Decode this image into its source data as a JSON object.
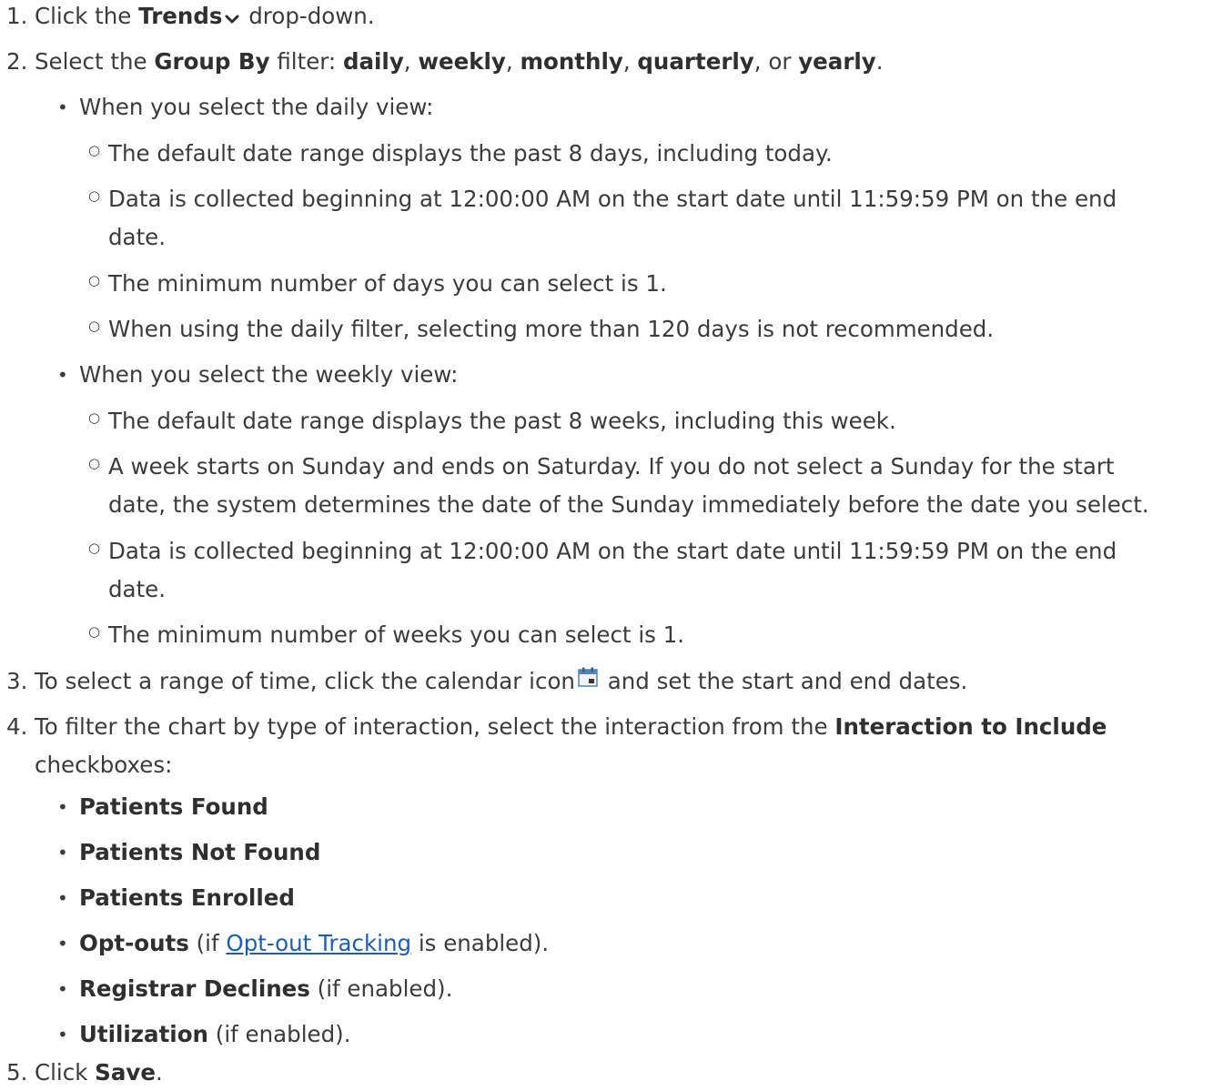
{
  "steps": [
    {
      "number": "1.",
      "pre": "Click the ",
      "bold": "Trends",
      "icon": "chevron-down-icon",
      "post": " drop-down."
    },
    {
      "number": "2.",
      "pre": "Select the ",
      "bold1": "Group By",
      "mid1": " filter: ",
      "opt_daily": "daily",
      "sep1": ", ",
      "opt_weekly": "weekly",
      "sep2": ", ",
      "opt_monthly": "monthly",
      "sep3": ", ",
      "opt_quarterly": "quarterly",
      "sep4": ", or ",
      "opt_yearly": "yearly",
      "end": ".",
      "daily": {
        "heading": "When you select the daily view:",
        "items": [
          "The default date range displays the past 8 days, including today.",
          "Data is collected beginning at 12:00:00 AM on the start date until 11:59:59 PM on the end",
          "date.",
          "The minimum number of days you can select is 1.",
          "When using the daily filter, selecting more than 120 days is not recommended."
        ]
      },
      "weekly": {
        "heading": "When you select the weekly view:",
        "items": [
          "The default date range displays the past 8 weeks, including this week.",
          "A week starts on Sunday and ends on Saturday. If you do not select a Sunday for the start",
          "date, the system determines the date of the Sunday immediately before the date you select.",
          "Data is collected beginning at 12:00:00 AM on the start date until 11:59:59 PM on the end",
          "date.",
          "The minimum number of weeks you can select is 1."
        ]
      }
    },
    {
      "number": "3.",
      "pre": "To select a range of time, click the calendar icon",
      "icon": "calendar-icon",
      "post": " and set the start and end dates."
    },
    {
      "number": "4.",
      "pre": "To filter the chart by type of interaction, select the interaction from the ",
      "bold": "Interaction to Include",
      "line2": "checkboxes:",
      "items": [
        {
          "bold": "Patients Found",
          "rest": ""
        },
        {
          "bold": "Patients Not Found",
          "rest": ""
        },
        {
          "bold": "Patients Enrolled",
          "rest": ""
        },
        {
          "bold": "Opt-outs",
          "pre_link": " (if ",
          "link": "Opt-out Tracking",
          "rest": " is enabled)."
        },
        {
          "bold": "Registrar Declines",
          "rest": " (if enabled)."
        },
        {
          "bold": "Utilization",
          "rest": " (if enabled)."
        }
      ]
    },
    {
      "number": "5.",
      "pre": "Click ",
      "bold": "Save",
      "end": "."
    }
  ],
  "bullet_glyph": "•",
  "sub_bullet_glyph": "○"
}
